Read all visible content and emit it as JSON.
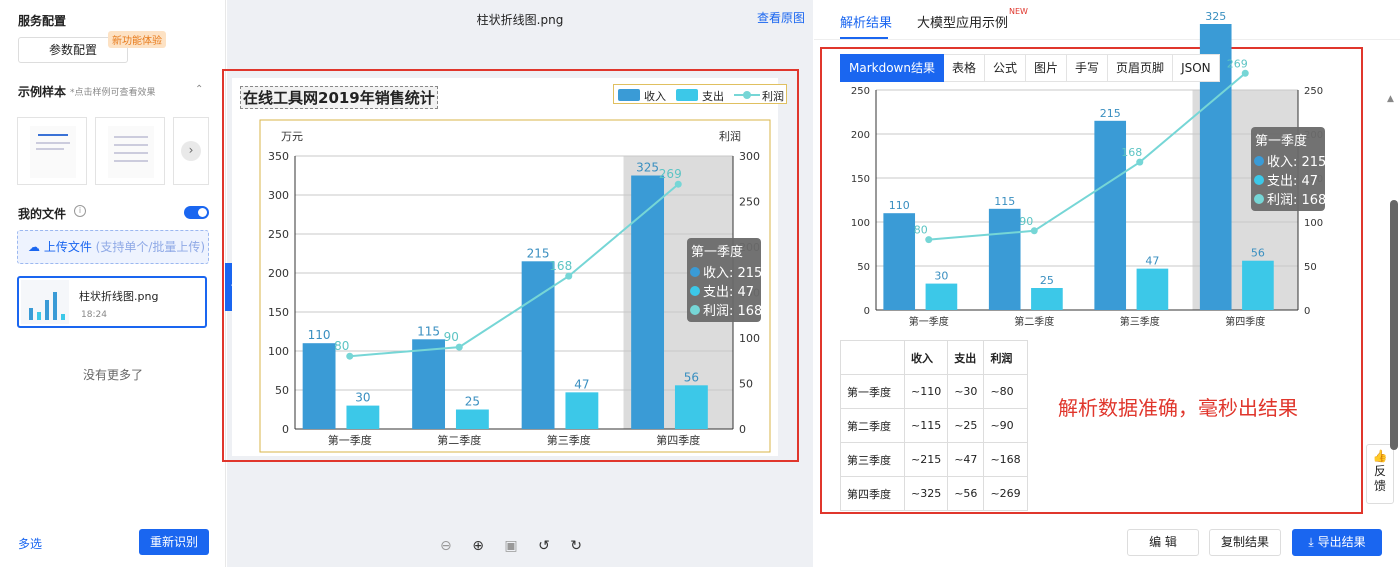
{
  "sidebar": {
    "service_title": "服务配置",
    "param_button": "参数配置",
    "new_badge": "新功能体验",
    "samples_title": "示例样本",
    "samples_hint": "*点击样例可查看效果",
    "my_files_title": "我的文件",
    "upload_label": "上传文件",
    "upload_sub": "(支持单个/批量上传)",
    "file_name": "柱状折线图.png",
    "file_time": "18:24",
    "no_more": "没有更多了",
    "multi_select": "多选",
    "re_recognize": "重新识别"
  },
  "preview": {
    "file_title": "柱状折线图.png",
    "view_original": "查看原图",
    "zoom_icons": [
      "zoom-out-icon",
      "zoom-in-icon",
      "fit-icon",
      "rotate-left-icon",
      "rotate-right-icon"
    ]
  },
  "right": {
    "tab_result": "解析结果",
    "tab_llm": "大模型应用示例",
    "tab_new": "NEW",
    "subtabs": [
      "Markdown结果",
      "表格",
      "公式",
      "图片",
      "手写",
      "页眉页脚",
      "JSON"
    ],
    "table_header": [
      "",
      "收入",
      "支出",
      "利润"
    ],
    "table_rows": [
      [
        "第一季度",
        "~110",
        "~30",
        "~80"
      ],
      [
        "第二季度",
        "~115",
        "~25",
        "~90"
      ],
      [
        "第三季度",
        "~215",
        "~47",
        "~168"
      ],
      [
        "第四季度",
        "~325",
        "~56",
        "~269"
      ]
    ],
    "note": "解析数据准确，毫秒出结果",
    "feedback": "反馈",
    "btn_edit": "编 辑",
    "btn_copy": "复制结果",
    "btn_export": "导出结果"
  },
  "chart_data": [
    {
      "type": "bar",
      "title": "在线工具网2019年销售统计",
      "categories": [
        "第一季度",
        "第二季度",
        "第三季度",
        "第四季度"
      ],
      "series": [
        {
          "name": "收入",
          "values": [
            110,
            115,
            215,
            325
          ],
          "color": "#3a9bd6"
        },
        {
          "name": "支出",
          "values": [
            30,
            25,
            47,
            56
          ],
          "color": "#3cc8e8"
        },
        {
          "name": "利润",
          "values": [
            80,
            90,
            168,
            269
          ],
          "color": "#76d6d6",
          "type": "line",
          "axis": "right"
        }
      ],
      "ylabel": "万元",
      "y2label": "利润",
      "ylim": [
        0,
        350
      ],
      "y2lim": [
        0,
        300
      ],
      "yticks": [
        0,
        50,
        100,
        150,
        200,
        250,
        300,
        350
      ],
      "y2ticks": [
        0,
        50,
        100,
        150,
        200,
        250,
        300
      ],
      "tooltip": {
        "title": "第一季度",
        "lines": [
          "收入: 215",
          "支出: 47",
          "利润: 168"
        ]
      },
      "highlight_category": "第四季度"
    },
    {
      "type": "bar",
      "categories": [
        "第一季度",
        "第二季度",
        "第三季度",
        "第四季度"
      ],
      "series": [
        {
          "name": "收入",
          "values": [
            110,
            115,
            215,
            325
          ],
          "color": "#3a9bd6"
        },
        {
          "name": "支出",
          "values": [
            30,
            25,
            47,
            56
          ],
          "color": "#3cc8e8"
        },
        {
          "name": "利润",
          "values": [
            80,
            90,
            168,
            269
          ],
          "color": "#76d6d6",
          "type": "line",
          "axis": "right"
        }
      ],
      "ylim": [
        0,
        250
      ],
      "y2lim": [
        0,
        250
      ],
      "yticks": [
        0,
        50,
        100,
        150,
        200,
        250
      ],
      "y2ticks": [
        0,
        50,
        100,
        150,
        200,
        250
      ],
      "tooltip": {
        "title": "第一季度",
        "lines": [
          "收入: 215",
          "支出: 47",
          "利润: 168"
        ]
      },
      "highlight_category": "第四季度"
    }
  ]
}
